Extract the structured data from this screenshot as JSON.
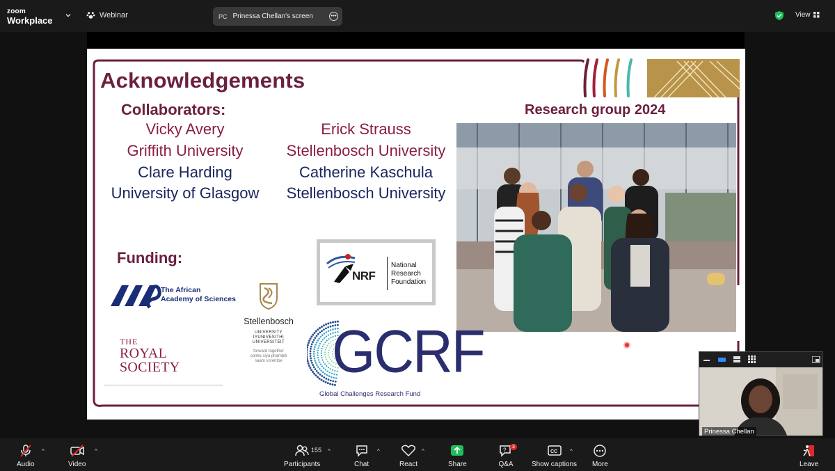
{
  "topbar": {
    "logo_line1": "zoom",
    "logo_line2": "Workplace",
    "meeting_type": "Webinar",
    "screen_share_initials": "PC",
    "screen_share_label": "Prinessa Chellan's screen",
    "view_label": "View"
  },
  "slide": {
    "title": "Acknowledgements",
    "collaborators_heading": "Collaborators:",
    "collaborators_left": [
      {
        "name": "Vicky Avery",
        "color": "#8b1d47"
      },
      {
        "name": "Griffith University",
        "color": "#8b1d47"
      },
      {
        "name": "Clare Harding",
        "color": "#1a2660"
      },
      {
        "name": "University of Glasgow",
        "color": "#1a2660"
      }
    ],
    "collaborators_right": [
      {
        "name": "Erick Strauss",
        "color": "#8b1d47"
      },
      {
        "name": "Stellenbosch University",
        "color": "#8b1d47"
      },
      {
        "name": "Catherine Kaschula",
        "color": "#1a2660"
      },
      {
        "name": "Stellenbosch University",
        "color": "#1a2660"
      }
    ],
    "research_group_title": "Research group 2024",
    "funding_heading": "Funding:",
    "aas_text_line1": "The African",
    "aas_text_line2": "Academy of Sciences",
    "royal_line1": "THE",
    "royal_line2": "ROYAL",
    "royal_line3": "SOCIETY",
    "stellenbosch_name": "Stellenbosch",
    "stellenbosch_uni1": "UNIVERSITY",
    "stellenbosch_uni2": "IYUNIVESITHI",
    "stellenbosch_uni3": "UNIVERSITEIT",
    "stellenbosch_motto1": "forward together",
    "stellenbosch_motto2": "sonke siya phambili",
    "stellenbosch_motto3": "saam vorentoe",
    "nrf_logo": "NRF",
    "nrf_line1": "National",
    "nrf_line2": "Research",
    "nrf_line3": "Foundation",
    "gcrf_logo": "GCRF",
    "gcrf_sub": "Global Challenges Research Fund"
  },
  "selfview": {
    "name": "Prinessa Chellan"
  },
  "toolbar": {
    "audio": "Audio",
    "video": "Video",
    "participants": "Participants",
    "participants_count": "155",
    "chat": "Chat",
    "react": "React",
    "share": "Share",
    "qa": "Q&A",
    "qa_badge": "3",
    "captions": "Show captions",
    "more": "More",
    "leave": "Leave"
  },
  "colors": {
    "maroon": "#6b1f3f",
    "navy": "#1a2660",
    "share_green": "#1dbf5a"
  }
}
